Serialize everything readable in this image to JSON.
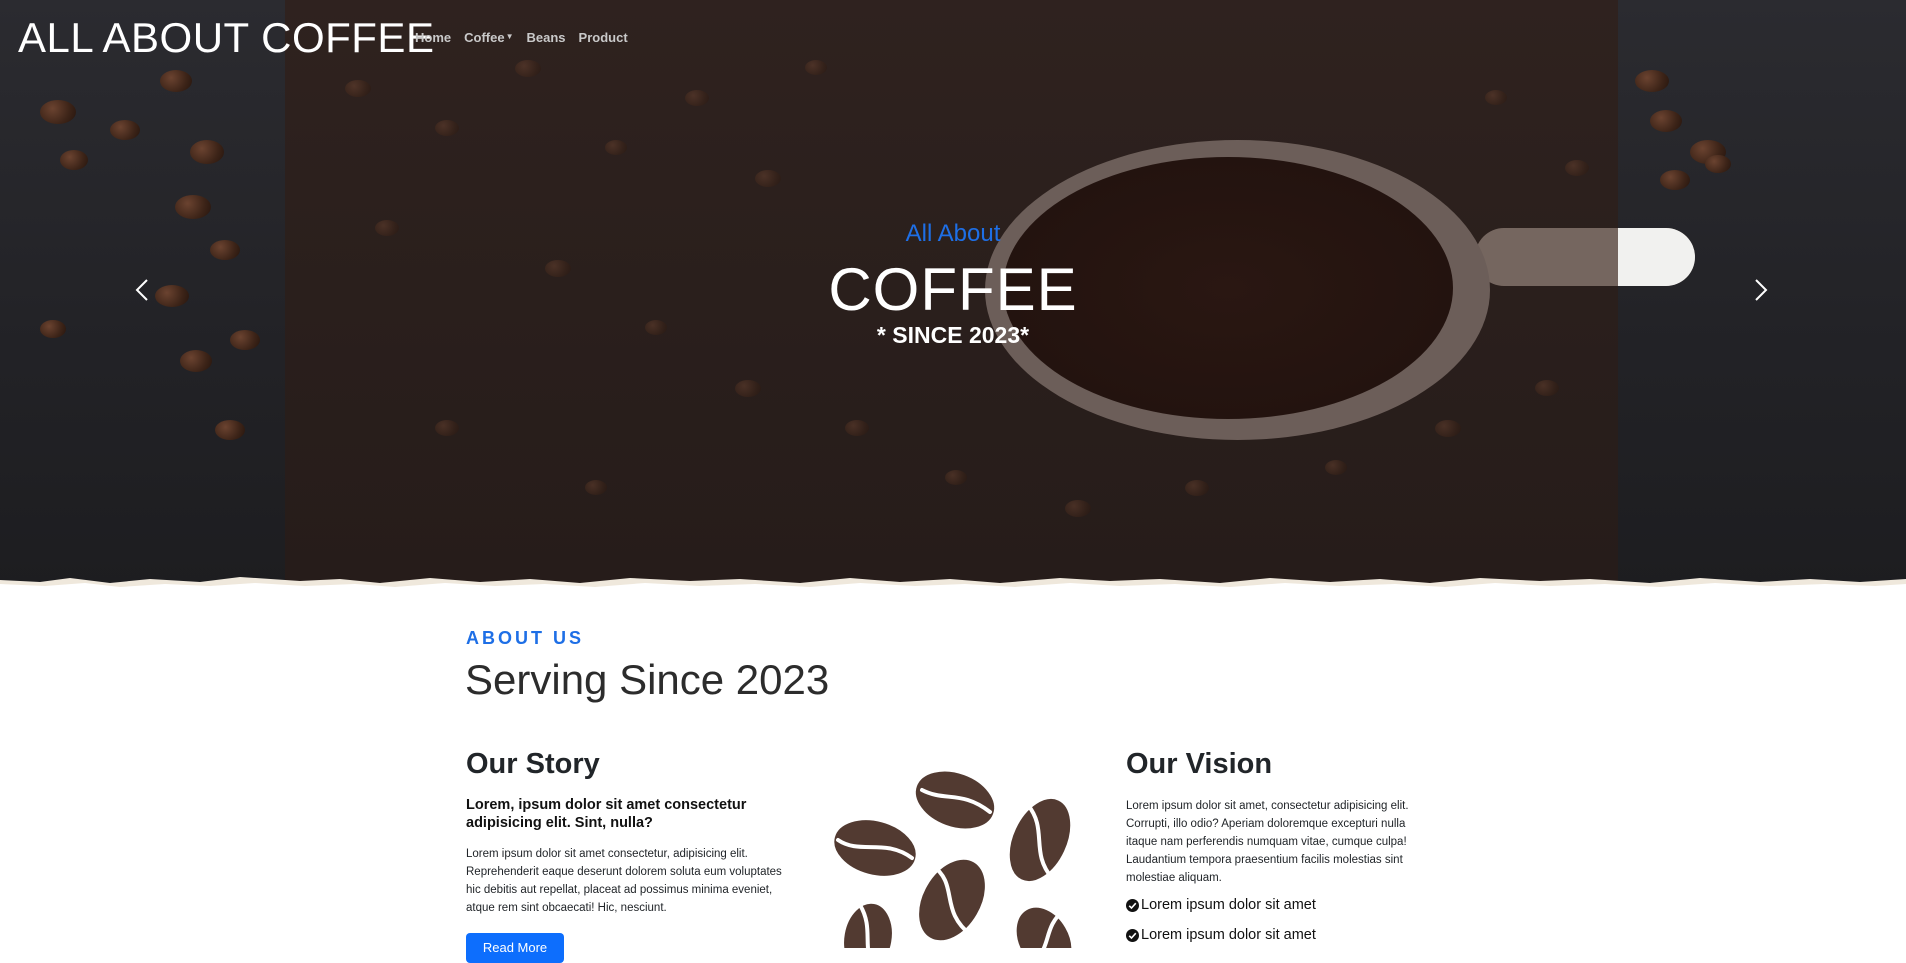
{
  "brand": {
    "title": "ALL ABOUT COFFEE"
  },
  "nav": {
    "items": [
      {
        "label": "Home"
      },
      {
        "label": "Coffee",
        "has_dropdown": true
      },
      {
        "label": "Beans"
      },
      {
        "label": "Product"
      }
    ]
  },
  "hero": {
    "eyebrow": "All About",
    "title": "COFFEE",
    "since": "* SINCE 2023*",
    "prev_icon": "chevron-left-icon",
    "next_icon": "chevron-right-icon"
  },
  "about": {
    "eyebrow": "ABOUT US",
    "heading": "Serving Since 2023",
    "story": {
      "title": "Our Story",
      "lead": "Lorem, ipsum dolor sit amet consectetur adipisicing elit. Sint, nulla?",
      "body": "Lorem ipsum dolor sit amet consectetur, adipisicing elit. Reprehenderit eaque deserunt dolorem soluta eum voluptates hic debitis aut repellat, placeat ad possimus minima eveniet, atque rem sint obcaecati! Hic, nesciunt.",
      "button": "Read More"
    },
    "vision": {
      "title": "Our Vision",
      "body": "Lorem ipsum dolor sit amet, consectetur adipisicing elit. Corrupti, illo odio? Aperiam doloremque excepturi nulla itaque nam perferendis numquam vitae, cumque culpa! Laudantium tempora praesentium facilis molestias sint molestiae aliquam.",
      "checks": [
        {
          "label": "Lorem ipsum dolor sit amet",
          "icon": "check-circle-icon"
        },
        {
          "label": "Lorem ipsum dolor sit amet",
          "icon": "check-circle-icon"
        }
      ]
    }
  },
  "colors": {
    "accent": "#1e6fe6",
    "button": "#0d6efd",
    "bean": "#523a31",
    "hero_panel": "#2a1f1c"
  }
}
